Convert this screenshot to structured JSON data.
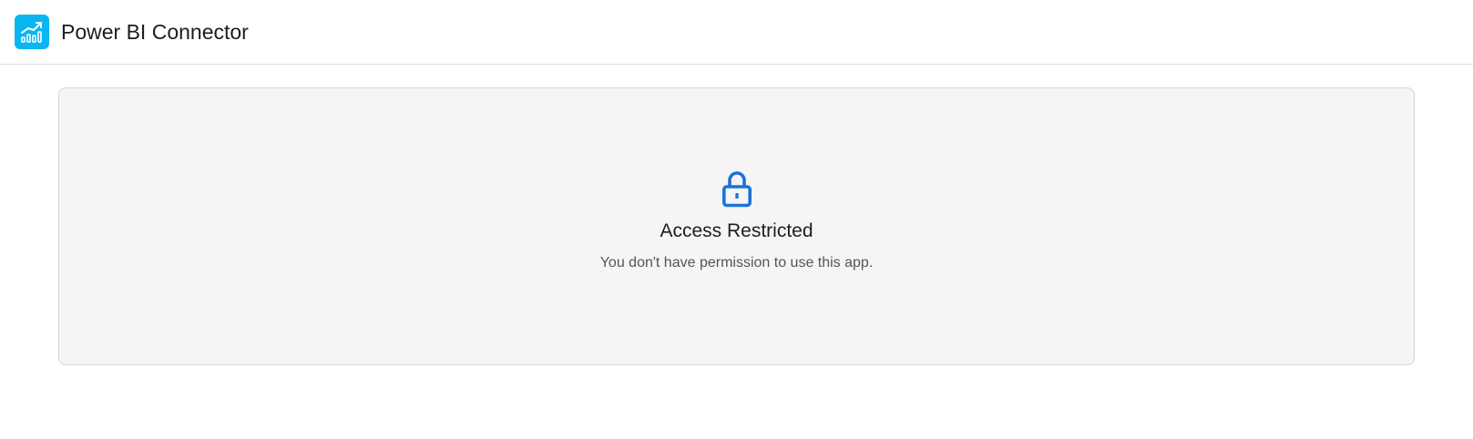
{
  "header": {
    "app_icon": "bar-chart-trend-icon",
    "title": "Power BI Connector"
  },
  "notice": {
    "icon": "lock-icon",
    "title": "Access Restricted",
    "message": "You don't have permission to use this app."
  },
  "colors": {
    "brand": "#0AB6F0",
    "lock": "#1A73D9",
    "panel_background": "#F5F5F5"
  }
}
